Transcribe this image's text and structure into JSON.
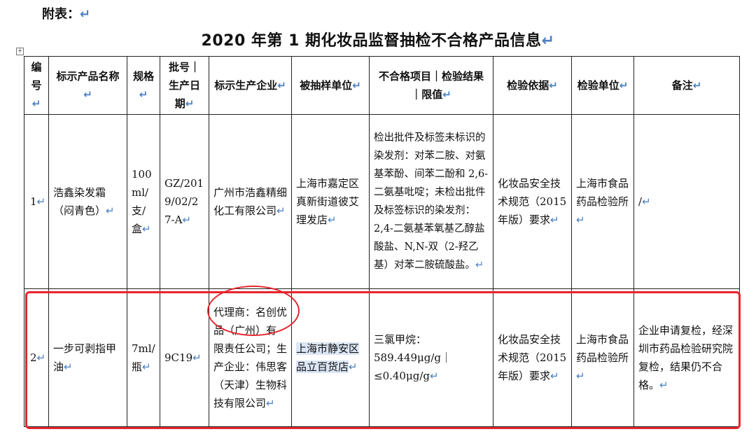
{
  "doc": {
    "appendix_label": "附表：",
    "title": "2020 年第 1 期化妆品监督抽检不合格产品信息",
    "table_handle": "+"
  },
  "table": {
    "headers": [
      "编号",
      "标示产品名称",
      "规格",
      "批号｜生产日期",
      "标示生产企业",
      "被抽样单位",
      "不合格项目｜检验结果｜限值",
      "检验依据",
      "检验单位",
      "备注"
    ],
    "rows": [
      {
        "num": "1",
        "name": "浩鑫染发霜（闷青色）",
        "spec": "100ml/支/盒",
        "batch": "GZ/2019/02/27-A",
        "maker": "广州市浩鑫精细化工有限公司",
        "sampled": "上海市嘉定区真新街道彼艾理发店",
        "item": "检出批件及标签未标识的染发剂：对苯二胺、对氨基苯酚、间苯二酚和 2,6-二氨基吡啶；未检出批件及标签标识的染发剂：2,4-二氨基苯氧基乙醇盐酸盐、N,N-双（2-羟乙基）对苯二胺硫酸盐。",
        "basis": "化妆品安全技术规范（2015 年版）要求",
        "lab": "上海市食品药品检验所",
        "note": "/"
      },
      {
        "num": "2",
        "name": "一步可剥指甲油",
        "spec": "7ml/瓶",
        "batch": "9C19",
        "maker_agent": "代理商：名创优品（广州）",
        "maker_rest": "有限责任公司；生产企业：伟思客（天津）生物科技有限公司",
        "sampled": "上海市静安区品立百货店",
        "item": "三氯甲烷：589.449μg/g｜≤0.40μg/g",
        "basis": "化妆品安全技术规范（2015 年版）要求",
        "lab": "上海市食品药品检验所",
        "note": "企业申请复检，经深圳市药品检验研究院复检，结果仍不合格。"
      }
    ]
  },
  "annotations": {
    "highlight_color": "#e5262e",
    "selection_color": "#dbe6f6"
  },
  "paragraph_mark": "↵"
}
